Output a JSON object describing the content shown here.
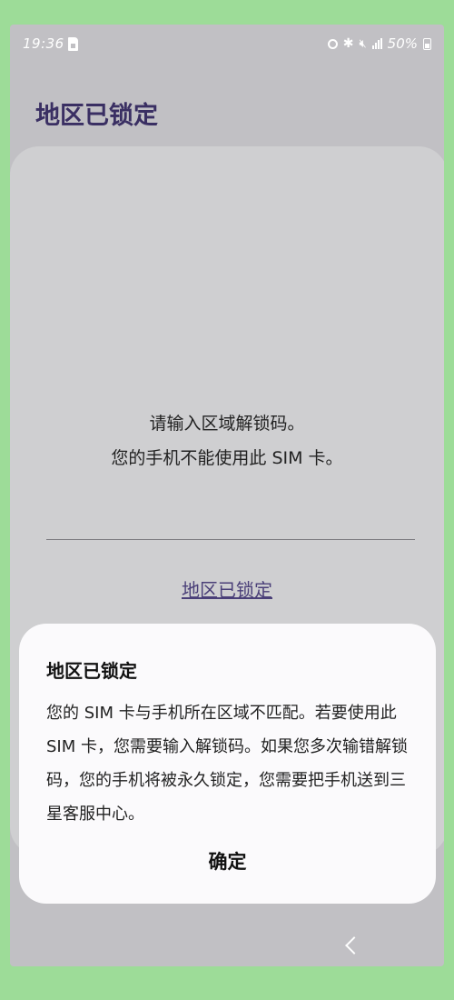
{
  "status_bar": {
    "time": "19:36",
    "battery": "50%",
    "icons": [
      "sim-card-icon",
      "alarm-icon",
      "bluetooth-icon",
      "mute-icon",
      "signal-icon",
      "battery-icon"
    ]
  },
  "header": {
    "title": "地区已锁定"
  },
  "main": {
    "message_line1": "请输入区域解锁码。",
    "message_line2": "您的手机不能使用此 SIM 卡。",
    "link_label": "地区已锁定"
  },
  "dialog": {
    "title": "地区已锁定",
    "body": "您的 SIM 卡与手机所在区域不匹配。若要使用此 SIM 卡，您需要输入解锁码。如果您多次输错解锁码，您的手机将被永久锁定，您需要把手机送到三星客服中心。",
    "confirm_label": "确定"
  },
  "nav_bar": {
    "icons": [
      "back-icon"
    ]
  },
  "colors": {
    "background": "#9ddc98",
    "screen_dim": "#c1c0c4",
    "title_accent": "#3a2f63",
    "link_accent": "#4a3f78",
    "dialog_bg": "#fbfafc"
  }
}
